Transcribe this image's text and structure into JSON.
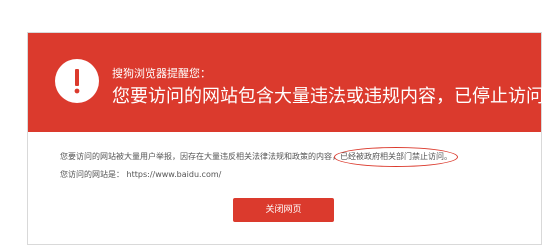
{
  "colors": {
    "accent": "#db3a2d",
    "banner_text": "#ffffff",
    "body_text": "#555555",
    "border": "#d9d9d9"
  },
  "banner": {
    "icon": "exclamation-icon",
    "subtitle": "搜狗浏览器提醒您：",
    "title": "您要访问的网站包含大量违法或违规内容，已停止访问。"
  },
  "body": {
    "reason_prefix": "您要访问的网站被大量用户举报，因存在大量违反相关法律法规和政策的内容，",
    "reason_highlight": "已经被政府相关部门禁止访问。",
    "url_label": "您访问的网站是：",
    "url_value": "https://www.baidu.com/"
  },
  "actions": {
    "close_label": "关闭网页"
  }
}
